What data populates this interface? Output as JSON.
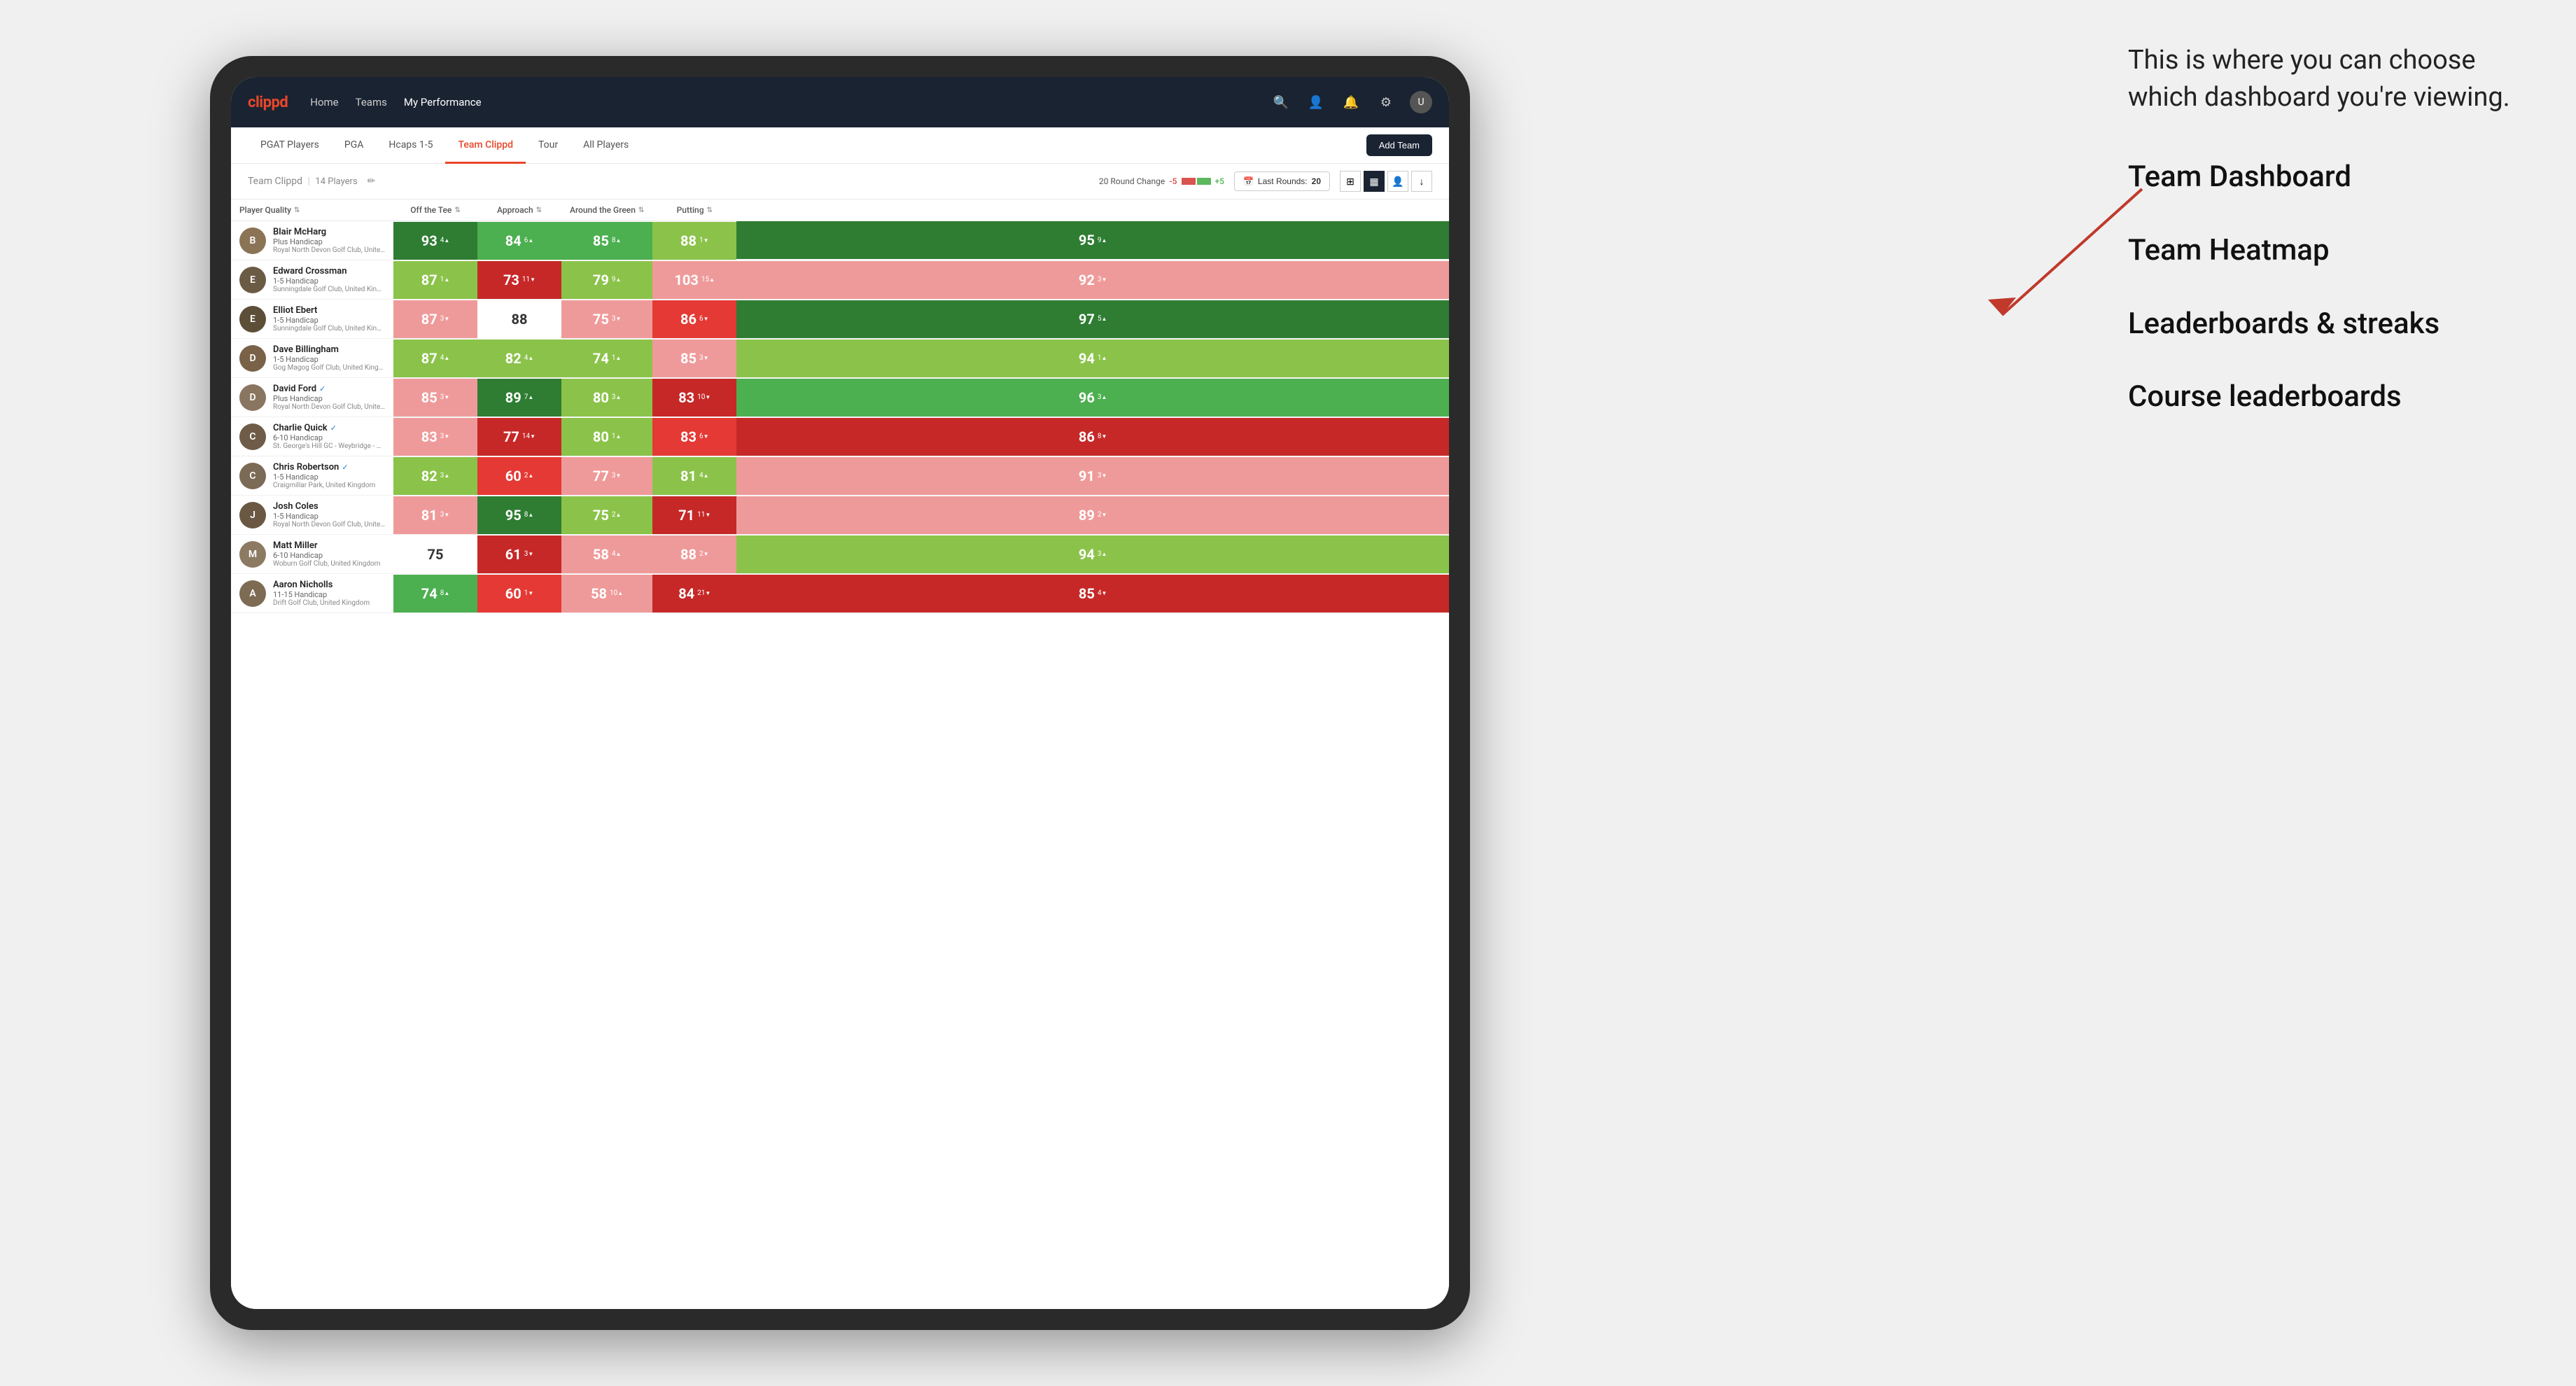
{
  "annotation": {
    "intro_text": "This is where you can choose which dashboard you're viewing.",
    "options": [
      "Team Dashboard",
      "Team Heatmap",
      "Leaderboards & streaks",
      "Course leaderboards"
    ]
  },
  "navbar": {
    "logo": "clippd",
    "links": [
      "Home",
      "Teams",
      "My Performance"
    ],
    "active_link": "My Performance"
  },
  "subnav": {
    "tabs": [
      "PGAT Players",
      "PGA",
      "Hcaps 1-5",
      "Team Clippd",
      "Tour",
      "All Players"
    ],
    "active_tab": "Team Clippd",
    "add_team_label": "Add Team"
  },
  "team_header": {
    "team_name": "Team Clippd",
    "separator": "|",
    "player_count": "14 Players",
    "round_change_label": "20 Round Change",
    "change_neg": "-5",
    "change_pos": "+5",
    "last_rounds_label": "Last Rounds:",
    "last_rounds_value": "20"
  },
  "table": {
    "columns": {
      "player_quality": "Player Quality",
      "off_tee": "Off the Tee",
      "approach": "Approach",
      "around_green": "Around the Green",
      "putting": "Putting"
    },
    "players": [
      {
        "name": "Blair McHarg",
        "handicap": "Plus Handicap",
        "club": "Royal North Devon Golf Club, United Kingdom",
        "avatar_color": "#8B7355",
        "avatar_letter": "B",
        "player_quality": {
          "score": 93,
          "change": "+4",
          "direction": "up",
          "color": "green-dark"
        },
        "off_tee": {
          "score": 84,
          "change": "6",
          "direction": "up",
          "color": "green-med"
        },
        "approach": {
          "score": 85,
          "change": "8",
          "direction": "up",
          "color": "green-med"
        },
        "around_green": {
          "score": 88,
          "change": "-1",
          "direction": "down",
          "color": "green-light"
        },
        "putting": {
          "score": 95,
          "change": "9",
          "direction": "up",
          "color": "green-dark"
        }
      },
      {
        "name": "Edward Crossman",
        "handicap": "1-5 Handicap",
        "club": "Sunningdale Golf Club, United Kingdom",
        "avatar_color": "#6B5B45",
        "avatar_letter": "E",
        "player_quality": {
          "score": 87,
          "change": "1",
          "direction": "up",
          "color": "green-light"
        },
        "off_tee": {
          "score": 73,
          "change": "-11",
          "direction": "down",
          "color": "red-dark"
        },
        "approach": {
          "score": 79,
          "change": "9",
          "direction": "up",
          "color": "green-light"
        },
        "around_green": {
          "score": 103,
          "change": "15",
          "direction": "up",
          "color": "red-light"
        },
        "putting": {
          "score": 92,
          "change": "-3",
          "direction": "down",
          "color": "red-light"
        }
      },
      {
        "name": "Elliot Ebert",
        "handicap": "1-5 Handicap",
        "club": "Sunningdale Golf Club, United Kingdom",
        "avatar_color": "#5D4E37",
        "avatar_letter": "E",
        "player_quality": {
          "score": 87,
          "change": "-3",
          "direction": "down",
          "color": "red-light"
        },
        "off_tee": {
          "score": 88,
          "change": "",
          "direction": "none",
          "color": "white"
        },
        "approach": {
          "score": 75,
          "change": "-3",
          "direction": "down",
          "color": "red-light"
        },
        "around_green": {
          "score": 86,
          "change": "-6",
          "direction": "down",
          "color": "red-med"
        },
        "putting": {
          "score": 97,
          "change": "5",
          "direction": "up",
          "color": "green-dark"
        }
      },
      {
        "name": "Dave Billingham",
        "handicap": "1-5 Handicap",
        "club": "Gog Magog Golf Club, United Kingdom",
        "avatar_color": "#7A6248",
        "avatar_letter": "D",
        "player_quality": {
          "score": 87,
          "change": "4",
          "direction": "up",
          "color": "green-light"
        },
        "off_tee": {
          "score": 82,
          "change": "4",
          "direction": "up",
          "color": "green-light"
        },
        "approach": {
          "score": 74,
          "change": "1",
          "direction": "up",
          "color": "green-light"
        },
        "around_green": {
          "score": 85,
          "change": "-3",
          "direction": "down",
          "color": "red-light"
        },
        "putting": {
          "score": 94,
          "change": "1",
          "direction": "up",
          "color": "green-light"
        }
      },
      {
        "name": "David Ford",
        "handicap": "Plus Handicap",
        "club": "Royal North Devon Golf Club, United Kingdom",
        "avatar_color": "#8A7560",
        "avatar_letter": "D",
        "verified": true,
        "player_quality": {
          "score": 85,
          "change": "-3",
          "direction": "down",
          "color": "red-light"
        },
        "off_tee": {
          "score": 89,
          "change": "7",
          "direction": "up",
          "color": "green-dark"
        },
        "approach": {
          "score": 80,
          "change": "3",
          "direction": "up",
          "color": "green-light"
        },
        "around_green": {
          "score": 83,
          "change": "-10",
          "direction": "down",
          "color": "red-dark"
        },
        "putting": {
          "score": 96,
          "change": "3",
          "direction": "up",
          "color": "green-med"
        }
      },
      {
        "name": "Charlie Quick",
        "handicap": "6-10 Handicap",
        "club": "St. George's Hill GC - Weybridge - Surrey, Uni...",
        "avatar_color": "#6E5C48",
        "avatar_letter": "C",
        "verified": true,
        "player_quality": {
          "score": 83,
          "change": "-3",
          "direction": "down",
          "color": "red-light"
        },
        "off_tee": {
          "score": 77,
          "change": "-14",
          "direction": "down",
          "color": "red-dark"
        },
        "approach": {
          "score": 80,
          "change": "1",
          "direction": "up",
          "color": "green-light"
        },
        "around_green": {
          "score": 83,
          "change": "-6",
          "direction": "down",
          "color": "red-med"
        },
        "putting": {
          "score": 86,
          "change": "-8",
          "direction": "down",
          "color": "red-dark"
        }
      },
      {
        "name": "Chris Robertson",
        "handicap": "1-5 Handicap",
        "club": "Craigmillar Park, United Kingdom",
        "avatar_color": "#7B6A55",
        "avatar_letter": "C",
        "verified": true,
        "player_quality": {
          "score": 82,
          "change": "3",
          "direction": "up",
          "color": "green-light"
        },
        "off_tee": {
          "score": 60,
          "change": "2",
          "direction": "up",
          "color": "red-med"
        },
        "approach": {
          "score": 77,
          "change": "-3",
          "direction": "down",
          "color": "red-light"
        },
        "around_green": {
          "score": 81,
          "change": "4",
          "direction": "up",
          "color": "green-light"
        },
        "putting": {
          "score": 91,
          "change": "-3",
          "direction": "down",
          "color": "red-light"
        }
      },
      {
        "name": "Josh Coles",
        "handicap": "1-5 Handicap",
        "club": "Royal North Devon Golf Club, United Kingdom",
        "avatar_color": "#6A5843",
        "avatar_letter": "J",
        "player_quality": {
          "score": 81,
          "change": "-3",
          "direction": "down",
          "color": "red-light"
        },
        "off_tee": {
          "score": 95,
          "change": "8",
          "direction": "up",
          "color": "green-dark"
        },
        "approach": {
          "score": 75,
          "change": "2",
          "direction": "up",
          "color": "green-light"
        },
        "around_green": {
          "score": 71,
          "change": "-11",
          "direction": "down",
          "color": "red-dark"
        },
        "putting": {
          "score": 89,
          "change": "-2",
          "direction": "down",
          "color": "red-light"
        }
      },
      {
        "name": "Matt Miller",
        "handicap": "6-10 Handicap",
        "club": "Woburn Golf Club, United Kingdom",
        "avatar_color": "#8C7A62",
        "avatar_letter": "M",
        "player_quality": {
          "score": 75,
          "change": "",
          "direction": "none",
          "color": "white"
        },
        "off_tee": {
          "score": 61,
          "change": "-3",
          "direction": "down",
          "color": "red-dark"
        },
        "approach": {
          "score": 58,
          "change": "4",
          "direction": "up",
          "color": "red-light"
        },
        "around_green": {
          "score": 88,
          "change": "-2",
          "direction": "down",
          "color": "red-light"
        },
        "putting": {
          "score": 94,
          "change": "3",
          "direction": "up",
          "color": "green-light"
        }
      },
      {
        "name": "Aaron Nicholls",
        "handicap": "11-15 Handicap",
        "club": "Drift Golf Club, United Kingdom",
        "avatar_color": "#7D6B54",
        "avatar_letter": "A",
        "player_quality": {
          "score": 74,
          "change": "8",
          "direction": "up",
          "color": "green-med"
        },
        "off_tee": {
          "score": 60,
          "change": "-1",
          "direction": "down",
          "color": "red-med"
        },
        "approach": {
          "score": 58,
          "change": "10",
          "direction": "up",
          "color": "red-light"
        },
        "around_green": {
          "score": 84,
          "change": "-21",
          "direction": "down",
          "color": "red-dark"
        },
        "putting": {
          "score": 85,
          "change": "-4",
          "direction": "down",
          "color": "red-dark"
        }
      }
    ]
  },
  "colors": {
    "green_dark": "#2e7d32",
    "green_med": "#43a047",
    "green_light": "#81c784",
    "red_dark": "#c62828",
    "red_med": "#e53935",
    "red_light": "#ef9a9a",
    "white": "#ffffff",
    "brand": "#e8472a"
  }
}
